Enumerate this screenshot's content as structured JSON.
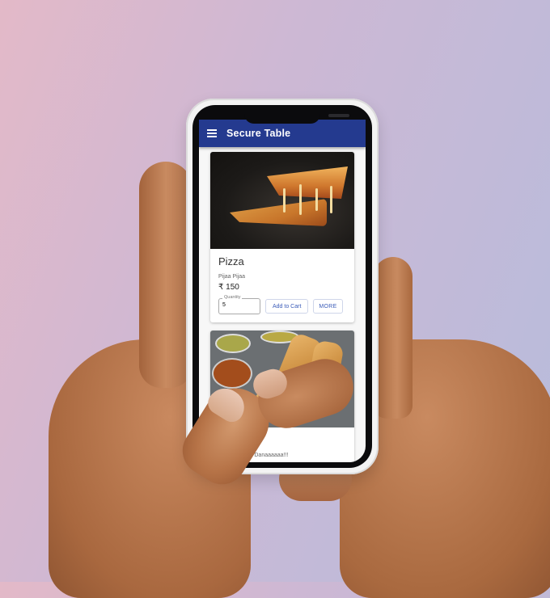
{
  "app": {
    "title": "Secure Table"
  },
  "menu": [
    {
      "name": "Pizza",
      "description": "Pijaa Pijaa",
      "price": "₹ 150",
      "quantity_label": "Quantity",
      "quantity_value": "5",
      "add_to_cart_label": "Add to Cart",
      "more_label": "MORE"
    },
    {
      "name": "Dosa",
      "description": "Anna Dosaaa Danaaaaaa!!!"
    }
  ],
  "colors": {
    "appbar": "#243a8f",
    "accent": "#3a5bb8"
  }
}
